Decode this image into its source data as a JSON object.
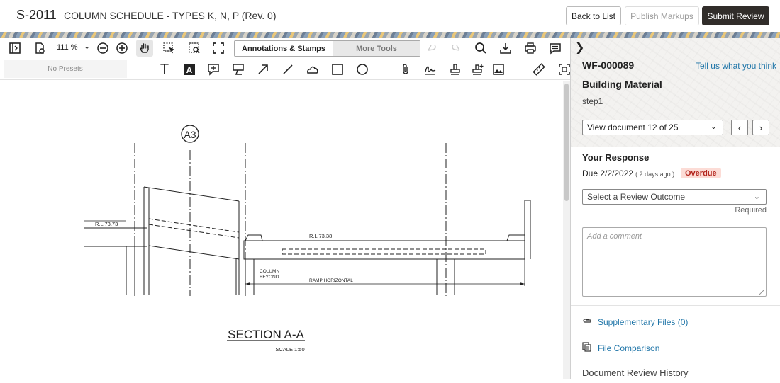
{
  "header": {
    "doc_id": "S-2011",
    "doc_title": "COLUMN SCHEDULE - TYPES K, N, P (Rev. 0)",
    "back_label": "Back to List",
    "publish_label": "Publish Markups",
    "submit_label": "Submit Review"
  },
  "toolbar": {
    "zoom": "111 %",
    "tab_annotations": "Annotations & Stamps",
    "tab_more": "More Tools",
    "presets": "No Presets",
    "icons_row1": [
      "sidebar-toggle-icon",
      "page-settings-icon",
      "zoom-out-icon",
      "zoom-in-icon",
      "hand-pan-icon",
      "select-area-icon",
      "zoom-area-icon",
      "fit-screen-icon",
      "undo-icon",
      "redo-icon",
      "search-icon",
      "download-icon",
      "print-icon",
      "comments-icon"
    ],
    "icons_row2": [
      "text-icon",
      "text-box-icon",
      "note-icon",
      "callout-icon",
      "arrow-icon",
      "line-icon",
      "cloud-icon",
      "rectangle-icon",
      "ellipse-icon",
      "attachment-icon",
      "signature-icon",
      "stamp-icon",
      "custom-stamp-icon",
      "image-icon",
      "measure-icon",
      "crop-icon"
    ]
  },
  "drawing": {
    "grid_label": "A3",
    "rl_left": "R.L 73.73",
    "rl_mid": "R.L 73.38",
    "column_beyond_1": "COLUMN",
    "column_beyond_2": "BEYOND",
    "ramp": "RAMP HORIZONTAL",
    "section": "SECTION A-A",
    "scale": "SCALE 1:50"
  },
  "panel": {
    "workflow_id": "WF-000089",
    "feedback_link": "Tell us what you think",
    "category": "Building Material",
    "step": "step1",
    "doc_selector": "View document 12 of 25",
    "response_title": "Your Response",
    "due": "Due 2/2/2022",
    "due_ago": "( 2 days ago )",
    "status": "Overdue",
    "outcome_placeholder": "Select a Review Outcome",
    "required": "Required",
    "comment_placeholder": "Add a comment",
    "supplementary": "Supplementary Files (0)",
    "file_comparison": "File Comparison",
    "history": "Document Review History"
  },
  "colors": {
    "primary_dark": "#312d2a",
    "link": "#1f75a8",
    "overdue_bg": "#fcdcd6",
    "overdue_text": "#b3261e"
  }
}
